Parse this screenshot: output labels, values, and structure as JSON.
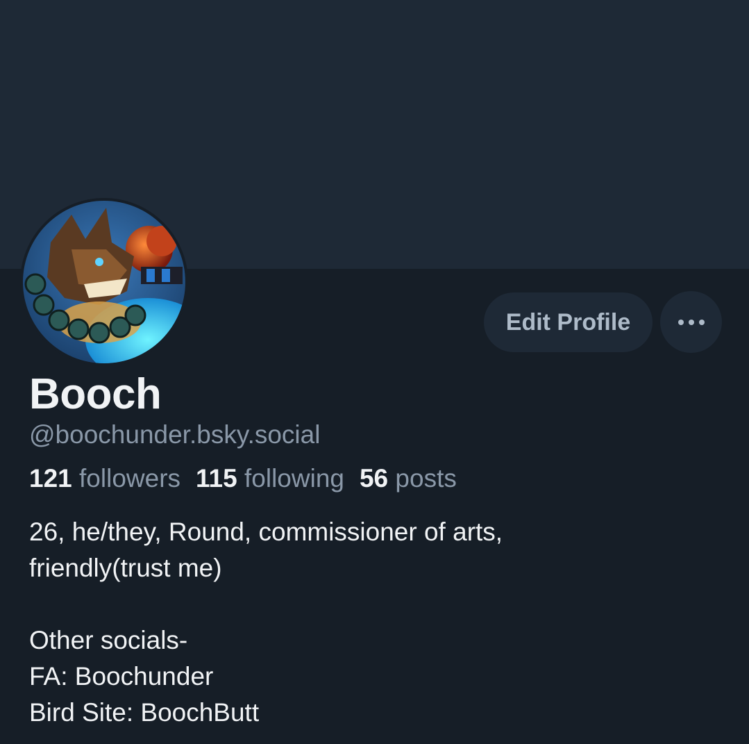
{
  "profile": {
    "display_name": "Booch",
    "handle": "@boochunder.bsky.social",
    "avatar_alt": "avatar"
  },
  "actions": {
    "edit_profile_label": "Edit Profile",
    "more_icon": "ellipsis-icon"
  },
  "stats": [
    {
      "value": "121",
      "label": "followers"
    },
    {
      "value": "115",
      "label": "following"
    },
    {
      "value": "56",
      "label": "posts"
    }
  ],
  "bio": {
    "line1": "26, he/they, Round, commissioner of arts,",
    "line2": "friendly(trust me)",
    "line3": "Other socials-",
    "line4": "FA: Boochunder",
    "line5": "Bird Site: BoochButt"
  },
  "colors": {
    "background": "#161e27",
    "banner": "#1e2936",
    "button_bg": "#1e2936",
    "text_primary": "#f1f3f5",
    "text_secondary": "#8a98a8"
  }
}
